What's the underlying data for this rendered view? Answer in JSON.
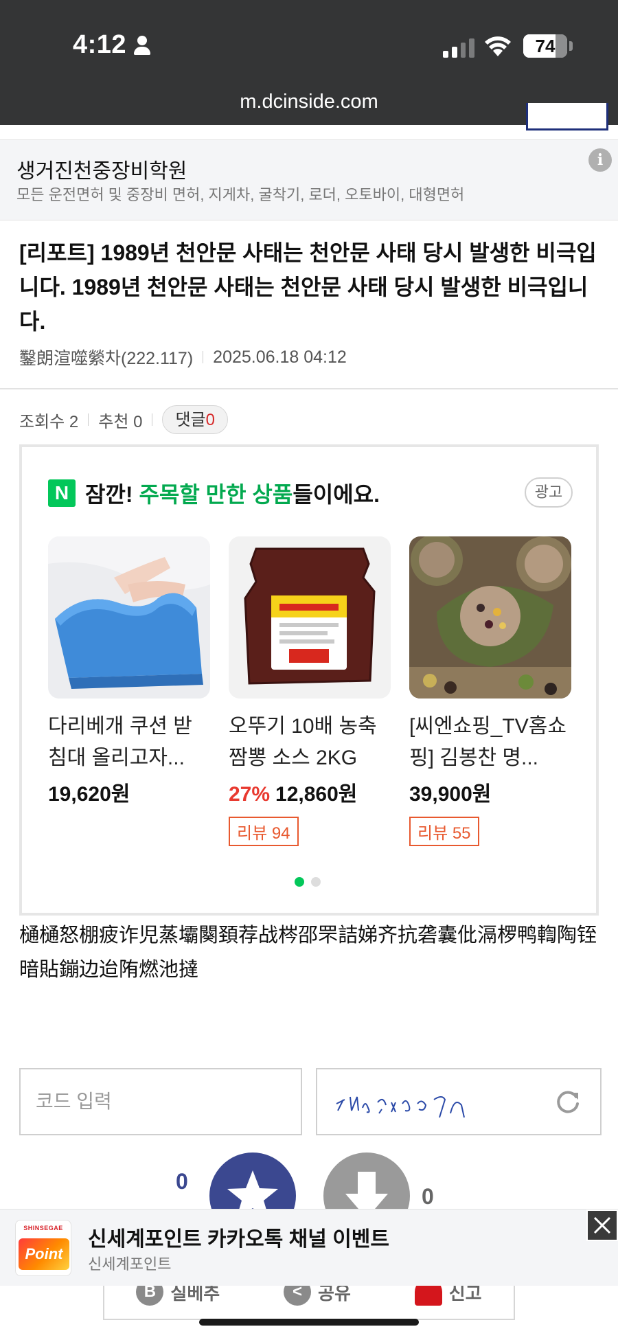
{
  "status_bar": {
    "time": "4:12",
    "battery": "74",
    "battery_level": 0.74,
    "signal_bars_active": 2,
    "signal_bars_total": 4
  },
  "browser": {
    "url": "m.dcinside.com"
  },
  "sponsored_banner": {
    "title": "생거진천중장비학원",
    "description": "모든 운전면허 및 중장비 면허, 지게차, 굴착기, 로더, 오토바이, 대형면허",
    "info_icon": "i"
  },
  "post": {
    "title": "[리포트] 1989년 천안문 사태는 천안문 사태 당시 발생한 비극입니다. 1989년 천안문 사태는 천안문 사태 당시 발생한 비극입니다.",
    "author": "鑿朗渲噬縈차(222.117)",
    "date": "2025.06.18 04:12",
    "views_label": "조회수 2",
    "recommend_label": "추천 0",
    "comments_label": "댓글",
    "comments_count": "0",
    "body": "樋樋怒棚疲诈児蒸壩闋頚荐战梣邵罘詰娣齐抗砻囊仳滆椤鸭輷陶铚暗貼鏰边迨陏燃池撻"
  },
  "shopping_ad": {
    "naver_badge": "N",
    "header_prefix": "잠깐! ",
    "header_highlight": "주목할 만한 상품",
    "header_suffix": "들이에요.",
    "ad_label": "광고",
    "products": [
      {
        "name": "다리베개 쿠션 받침대 올리고자...",
        "discount": "",
        "price": "19,620원",
        "review": ""
      },
      {
        "name": "오뚜기 10배 농축 짬뽕 소스 2KG",
        "discount": "27%",
        "price": "12,860원",
        "review": "리뷰 94"
      },
      {
        "name": "[씨엔쇼핑_TV홈쇼핑] 김봉찬 명...",
        "discount": "",
        "price": "39,900원",
        "review": "리뷰 55"
      }
    ],
    "carousel_pages": 2,
    "carousel_active": 1
  },
  "comment_form": {
    "code_placeholder": "코드 입력"
  },
  "votes": {
    "up": "0",
    "down": "0"
  },
  "action_bar": {
    "items": [
      "실베추",
      "공유",
      "신고"
    ]
  },
  "floating_ad": {
    "brand_small": "SHINSEGAE",
    "brand_word": "Point",
    "title": "신세계포인트 카카오톡 채널 이벤트",
    "subtitle": "신세계포인트"
  },
  "colors": {
    "status_bar_bg": "#343536",
    "naver_green": "#03c75a",
    "vote_up": "#3b4890",
    "vote_down": "#9a9a9a",
    "discount_red": "#e8392f",
    "review_orange": "#e8592f",
    "comment_count_red": "#d62b2b"
  }
}
